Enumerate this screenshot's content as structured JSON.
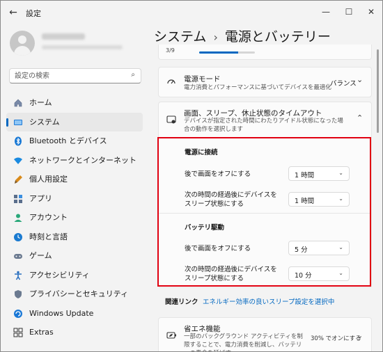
{
  "window": {
    "back_glyph": "←",
    "title": "設定",
    "minimize_glyph": "—",
    "maximize_glyph": "☐",
    "close_glyph": "✕"
  },
  "search": {
    "placeholder": "設定の検索",
    "icon": "search-icon",
    "icon_glyph": "⌕"
  },
  "sidebar": {
    "items": [
      {
        "label": "ホーム",
        "icon": "home-icon"
      },
      {
        "label": "システム",
        "icon": "system-icon",
        "active": true
      },
      {
        "label": "Bluetooth とデバイス",
        "icon": "bluetooth-icon"
      },
      {
        "label": "ネットワークとインターネット",
        "icon": "network-icon"
      },
      {
        "label": "個人用設定",
        "icon": "brush-icon"
      },
      {
        "label": "アプリ",
        "icon": "apps-icon"
      },
      {
        "label": "アカウント",
        "icon": "account-icon"
      },
      {
        "label": "時刻と言語",
        "icon": "clock-icon"
      },
      {
        "label": "ゲーム",
        "icon": "game-icon"
      },
      {
        "label": "アクセシビリティ",
        "icon": "accessibility-icon"
      },
      {
        "label": "プライバシーとセキュリティ",
        "icon": "shield-icon"
      },
      {
        "label": "Windows Update",
        "icon": "update-icon"
      },
      {
        "label": "Extras",
        "icon": "extras-icon"
      }
    ]
  },
  "header": {
    "breadcrumb_parent": "システム",
    "separator": "›",
    "title": "電源とバッテリー"
  },
  "progress": {
    "text": "3/9",
    "fraction": 0.7
  },
  "power_mode": {
    "title": "電源モード",
    "desc": "電力消費とパフォーマンスに基づいてデバイスを最適化",
    "value": "バランス",
    "chevron_glyph": "⌄"
  },
  "sleep": {
    "title": "画面、スリープ、休止状態のタイムアウト",
    "desc": "デバイスが指定された時間にわたりアイドル状態になった場合の動作を選択します",
    "chevron_glyph": "⌃",
    "plugged_in": {
      "heading": "電源に接続",
      "screen_label": "後で画面をオフにする",
      "screen_value": "1 時間",
      "sleep_label": "次の時間の経過後にデバイスをスリープ状態にする",
      "sleep_value": "1 時間"
    },
    "battery": {
      "heading": "バッテリ駆動",
      "screen_label": "後で画面をオフにする",
      "screen_value": "5 分",
      "sleep_label": "次の時間の経過後にデバイスをスリープ状態にする",
      "sleep_value": "10 分"
    },
    "dropdown_glyph": "⌄"
  },
  "related": {
    "label": "関連リンク",
    "link": "エネルギー効率の良いスリープ設定を選択中"
  },
  "energy_saver": {
    "title": "省エネ機能",
    "desc": "一部のバックグラウンド アクティビティを制限することで、電力消費を削減し、バッテリーの寿命を延ばす",
    "value": "30% でオンにする",
    "chevron_glyph": "⌄"
  },
  "colors": {
    "accent": "#0067c0",
    "highlight": "#e00010"
  }
}
